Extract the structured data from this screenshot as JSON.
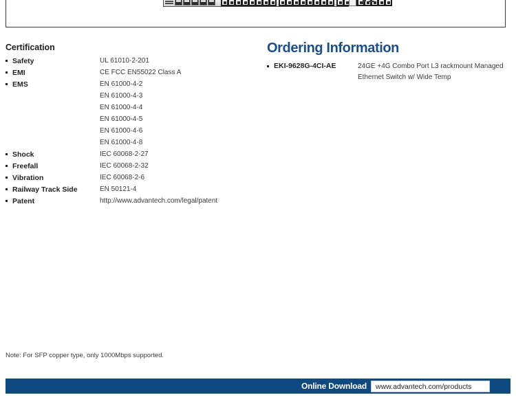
{
  "product_image": {
    "alt": "EKI-9628G-4CI rackmount managed ethernet switch front panel"
  },
  "certification": {
    "title": "Certification",
    "rows": [
      {
        "label": "Safety",
        "value": "UL 61010-2-201"
      },
      {
        "label": "EMI",
        "value": "CE FCC EN55022 Class A"
      },
      {
        "label": "EMS",
        "value": "EN 61000-4-2"
      },
      {
        "label": "",
        "value": "EN 61000-4-3"
      },
      {
        "label": "",
        "value": "EN 61000-4-4"
      },
      {
        "label": "",
        "value": "EN 61000-4-5"
      },
      {
        "label": "",
        "value": "EN 61000-4-6"
      },
      {
        "label": "",
        "value": "EN 61000-4-8"
      },
      {
        "label": "Shock",
        "value": "IEC 60068-2-27"
      },
      {
        "label": "Freefall",
        "value": "IEC 60068-2-32"
      },
      {
        "label": "Vibration",
        "value": "IEC 60068-2-6"
      },
      {
        "label": "Railway Track Side",
        "value": "EN 50121-4"
      },
      {
        "label": "Patent",
        "value": "http://www.advantech.com/legal/patent"
      }
    ]
  },
  "ordering": {
    "title": "Ordering Information",
    "items": [
      {
        "sku": "EKI-9628G-4CI-AE",
        "description": "24GE +4G Combo Port L3 rackmount Managed Ethernet Switch w/ Wide Temp"
      }
    ]
  },
  "note": "Note: For SFP copper type, only 1000Mbps supported.",
  "footer": {
    "label": "Online Download",
    "url": "www.advantech.com/products"
  },
  "colors": {
    "brand_blue": "#1c4f87",
    "footer_blue": "#104880",
    "text": "#231f20"
  }
}
